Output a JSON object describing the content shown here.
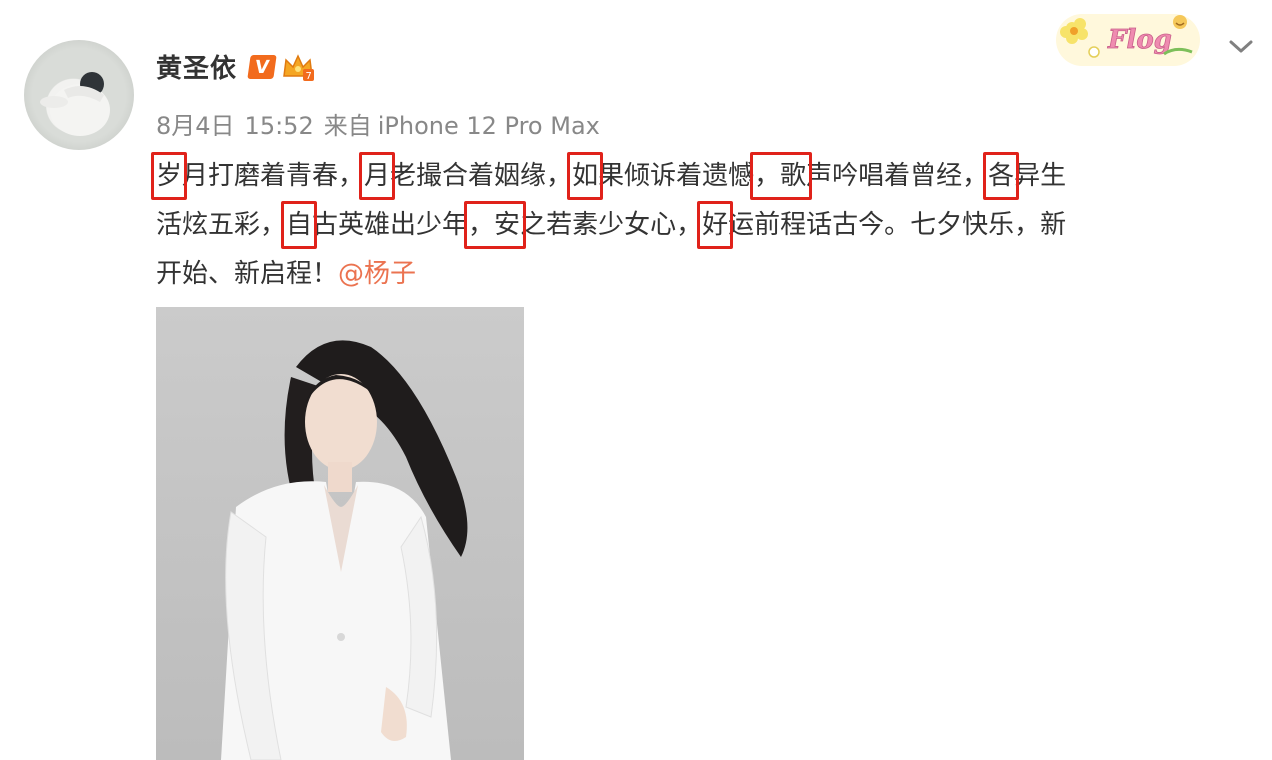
{
  "user": {
    "name": "黄圣依",
    "verified_label": "V"
  },
  "meta": {
    "date": "8月4日",
    "time": "15:52",
    "via": "来自",
    "source": "iPhone 12 Pro Max"
  },
  "post": {
    "line1": {
      "a": "岁",
      "b": "月打磨着青春，",
      "c": "月",
      "d": "老撮合着姻缘，",
      "e": "如",
      "f": "果倾诉着遗憾",
      "g": "，歌",
      "h": "声吟唱着曾经，",
      "i": "各",
      "j": "异生"
    },
    "line2": {
      "a": "活炫五彩，",
      "b": "自",
      "c": "古英雄出少年",
      "d": "，安",
      "e": "之若素少女心，",
      "f": "好",
      "g": "运前程话古今。七夕快乐，新"
    },
    "line3": {
      "a": "开始、新启程！",
      "mention": "@杨子"
    }
  },
  "sticker": {
    "text": "Flog"
  },
  "icons": {
    "menu": "chevron-down-icon",
    "crown": "crown-badge-icon",
    "sticker": "flower-sticker"
  },
  "colors": {
    "accent": "#eb7350",
    "vbadge": "#f26b1d",
    "highlight": "#e0221a"
  }
}
